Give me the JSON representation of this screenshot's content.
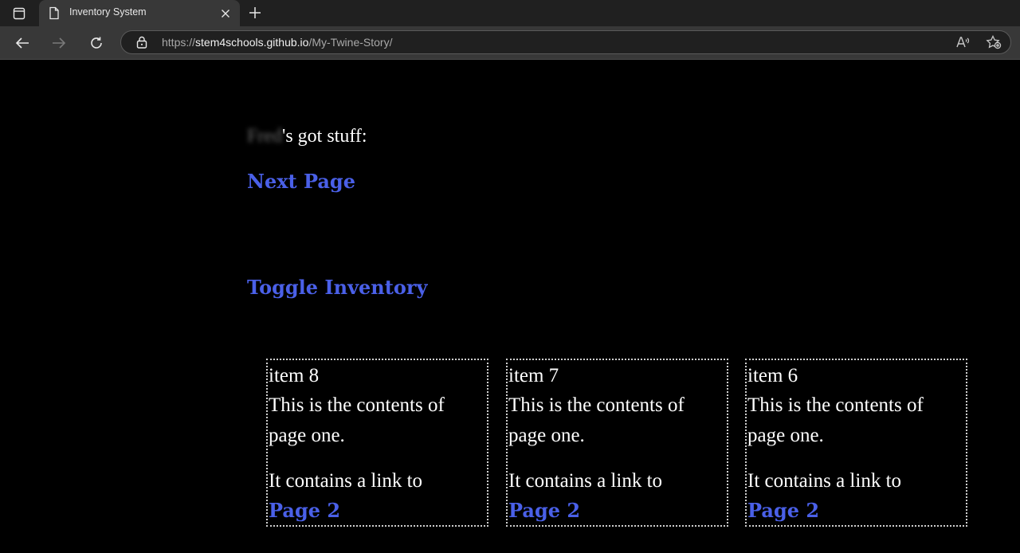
{
  "browser": {
    "tab_title": "Inventory System",
    "url_prefix": "https://",
    "url_host": "stem4schools.github.io",
    "url_path": "/My-Twine-Story/"
  },
  "story": {
    "player_name": "Fred",
    "got_stuff_suffix": "'s got stuff:",
    "next_page_link": "Next Page",
    "toggle_inventory_link": "Toggle Inventory",
    "items": [
      {
        "title": "item 8",
        "contents": "This is the contents of page one.",
        "contains": "It contains a link to",
        "link": "Page 2"
      },
      {
        "title": "item 7",
        "contents": "This is the contents of page one.",
        "contains": "It contains a link to",
        "link": "Page 2"
      },
      {
        "title": "item 6",
        "contents": "This is the contents of page one.",
        "contains": "It contains a link to",
        "link": "Page 2"
      }
    ]
  },
  "colors": {
    "link": "#4a60e8",
    "background": "#000000",
    "text": "#ffffff"
  }
}
